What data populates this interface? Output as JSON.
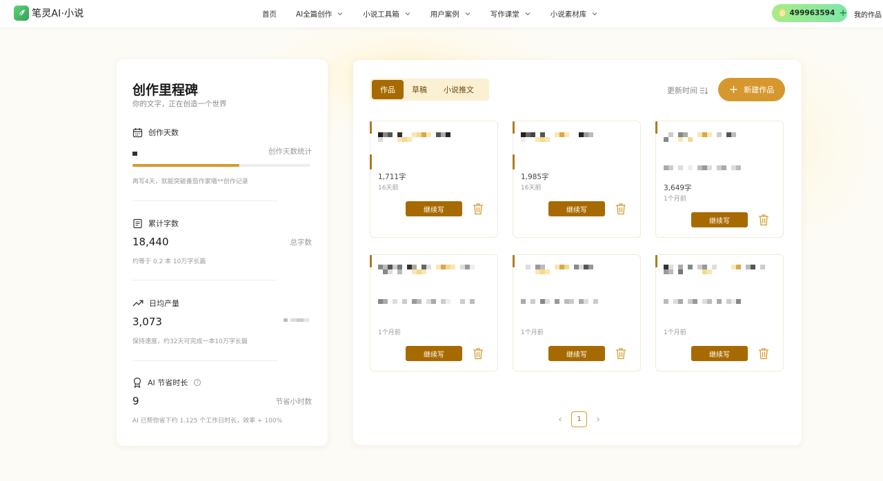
{
  "header": {
    "logo_text": "笔灵AI·小说",
    "nav": [
      {
        "label": "首页",
        "has_dropdown": false
      },
      {
        "label": "AI全篇创作",
        "has_dropdown": true
      },
      {
        "label": "小说工具箱",
        "has_dropdown": true
      },
      {
        "label": "用户案例",
        "has_dropdown": true
      },
      {
        "label": "写作课堂",
        "has_dropdown": true
      },
      {
        "label": "小说素材库",
        "has_dropdown": true
      }
    ],
    "balance": "499963594",
    "balance_plus": "+",
    "my_works": "我的作品"
  },
  "milestones": {
    "title": "创作里程碑",
    "subtitle": "你的文字，正在创造一个世界",
    "days": {
      "label": "创作天数",
      "unit": "创作天数统计",
      "progress_percent": 60,
      "note": "再写4天，就能突破番茄作家喵**创作记录"
    },
    "words": {
      "label": "累计字数",
      "value": "18,440",
      "unit": "总字数",
      "note": "约等于 0.2 本 10万字长篇"
    },
    "daily": {
      "label": "日均产量",
      "value": "3,073",
      "note": "保持速度，约32天可完成一本10万字长篇"
    },
    "ai_saved": {
      "label": "AI 节省时长",
      "help": "?",
      "value": "9",
      "unit": "节省小时数",
      "note": "AI 已帮你省下约 1.125 个工作日时长，效率 + 100%"
    }
  },
  "works": {
    "tabs": [
      {
        "label": "作品",
        "active": true
      },
      {
        "label": "草稿",
        "active": false
      },
      {
        "label": "小说推文",
        "active": false
      }
    ],
    "sort_label": "更新时间",
    "new_button": "新建作品",
    "new_plus": "+",
    "continue_label": "继续写",
    "cards": [
      {
        "words": "1,711字",
        "time": "16天前"
      },
      {
        "words": "1,985字",
        "time": "16天前"
      },
      {
        "words": "3,649字",
        "time": "1个月前"
      },
      {
        "words": "",
        "time": "1个月前"
      },
      {
        "words": "",
        "time": "1个月前"
      },
      {
        "words": "",
        "time": "1个月前"
      }
    ],
    "pager": {
      "prev": "‹",
      "current": "1",
      "next": "›"
    }
  },
  "colors": {
    "accent": "#a76a00",
    "accent_light": "#d6982e",
    "tab_bg": "#fbf0d2",
    "balance_start": "#a7ec86",
    "balance_end": "#7fe6a8"
  }
}
